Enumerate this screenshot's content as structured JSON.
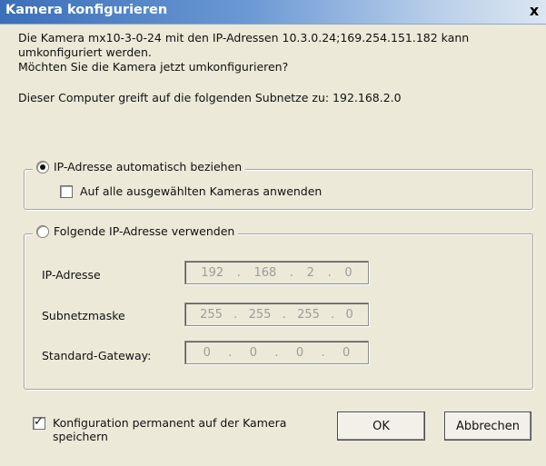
{
  "window": {
    "title": "Kamera konfigurieren",
    "close_glyph": "x"
  },
  "message": {
    "line1": "Die Kamera mx10-3-0-24 mit den IP-Adressen 10.3.0.24;169.254.151.182 kann",
    "line2": "umkonfiguriert werden.",
    "line3": "Möchten Sie die Kamera jetzt umkonfigurieren?",
    "line4": "Dieser Computer greift auf die folgenden Subnetze zu: 192.168.2.0"
  },
  "auto_group": {
    "radio_label": "IP-Adresse automatisch beziehen",
    "radio_selected": true,
    "apply_all_label": "Auf alle ausgewählten Kameras anwenden",
    "apply_all_checked": false
  },
  "manual_group": {
    "radio_label": "Folgende IP-Adresse verwenden",
    "radio_selected": false,
    "fields": [
      {
        "label": "IP-Adresse",
        "octets": [
          "192",
          "168",
          "2",
          "0"
        ]
      },
      {
        "label": "Subnetzmaske",
        "octets": [
          "255",
          "255",
          "255",
          "0"
        ]
      },
      {
        "label": "Standard-Gateway:",
        "octets": [
          "0",
          "0",
          "0",
          "0"
        ]
      }
    ]
  },
  "footer": {
    "permanent_label_line1": "Konfiguration permanent auf der Kamera",
    "permanent_label_line2": "speichern",
    "permanent_checked": true,
    "check_glyph": "✓",
    "ok_label": "OK",
    "cancel_label": "Abbrechen"
  }
}
